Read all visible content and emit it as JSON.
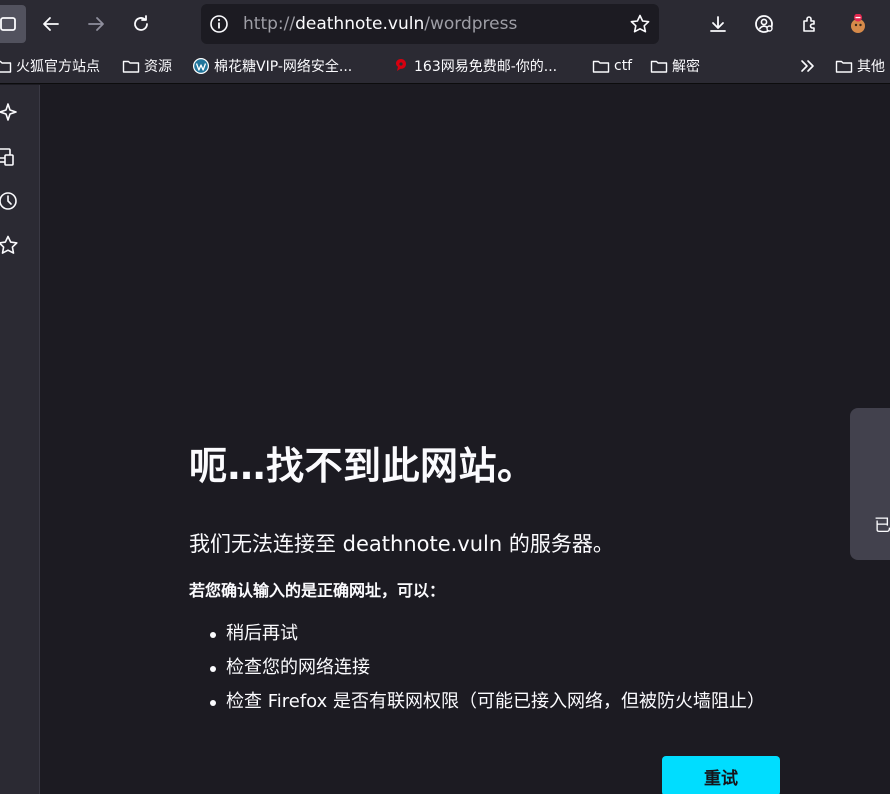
{
  "browser": {
    "url_scheme": "http://",
    "url_host": "deathnote.vuln",
    "url_path": "/wordpress"
  },
  "bookmarks": [
    {
      "label": "火狐官方站点",
      "icon": "folder-icon"
    },
    {
      "label": "资源",
      "icon": "folder-icon"
    },
    {
      "label": "棉花糖VIP-网络安全...",
      "icon": "wordpress-icon"
    },
    {
      "label": "163网易免费邮-你的...",
      "icon": "netease-icon"
    },
    {
      "label": "ctf",
      "icon": "folder-icon"
    },
    {
      "label": "解密",
      "icon": "folder-icon"
    },
    {
      "label": "其他",
      "icon": "folder-icon"
    }
  ],
  "error": {
    "title": "呃…找不到此网站。",
    "description": "我们无法连接至 deathnote.vuln 的服务器。",
    "hint": "若您确认输入的是正确网址，可以：",
    "suggestions": [
      "稍后再试",
      "检查您的网络连接",
      "检查 Firefox 是否有联网权限（可能已接入网络，但被防火墙阻止）"
    ],
    "retry_label": "重试"
  },
  "side_panel_text": "已",
  "colors": {
    "accent": "#00ddff",
    "toolbar": "#2b2a33",
    "page": "#1c1b22"
  }
}
